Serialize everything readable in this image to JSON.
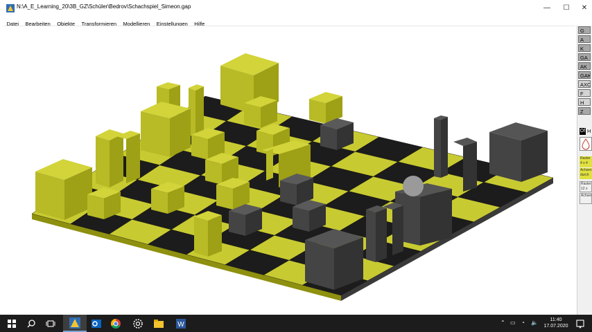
{
  "window": {
    "title": "N:\\A_E_Learning_20\\3B_GZ\\Schüler\\Bedrov\\Schachspiel_Simeon.gap",
    "controls": {
      "minimize": "—",
      "maximize": "☐",
      "close": "✕"
    }
  },
  "menu": [
    "Datei",
    "Bearbeiten",
    "Objekte",
    "Transformieren",
    "Modellieren",
    "Einstellungen",
    "Hilfe"
  ],
  "sidebar": {
    "buttons": [
      "G",
      "A",
      "K",
      "GA",
      "AK",
      "GAK",
      "AXO",
      "F",
      "H",
      "Z"
    ],
    "cube_label": "Of",
    "h_label": "H",
    "panel_labels": [
      {
        "line1": "Raster",
        "line2": "4 x 4"
      },
      {
        "line1": "Achsen",
        "line2": "durch"
      },
      {
        "line1": "Raster",
        "line2": "12 x 12"
      },
      {
        "line1": "Achsen",
        "line2": ""
      }
    ]
  },
  "colors": {
    "yellow_top": "#c3c52e",
    "yellow_side": "#a8aa1e",
    "yellow_front": "#8e900f",
    "dark_top": "#505050",
    "dark_side": "#3a3a3a",
    "dark_front": "#2b2b2b",
    "board_black": "#1c1c1c",
    "board_yellow": "#c8ca32"
  },
  "taskbar": {
    "time": "11:40",
    "date": "17.07.2020",
    "tray_icons": [
      "chevron-up-icon",
      "network-icon",
      "sound-icon",
      "notification-icon"
    ]
  }
}
